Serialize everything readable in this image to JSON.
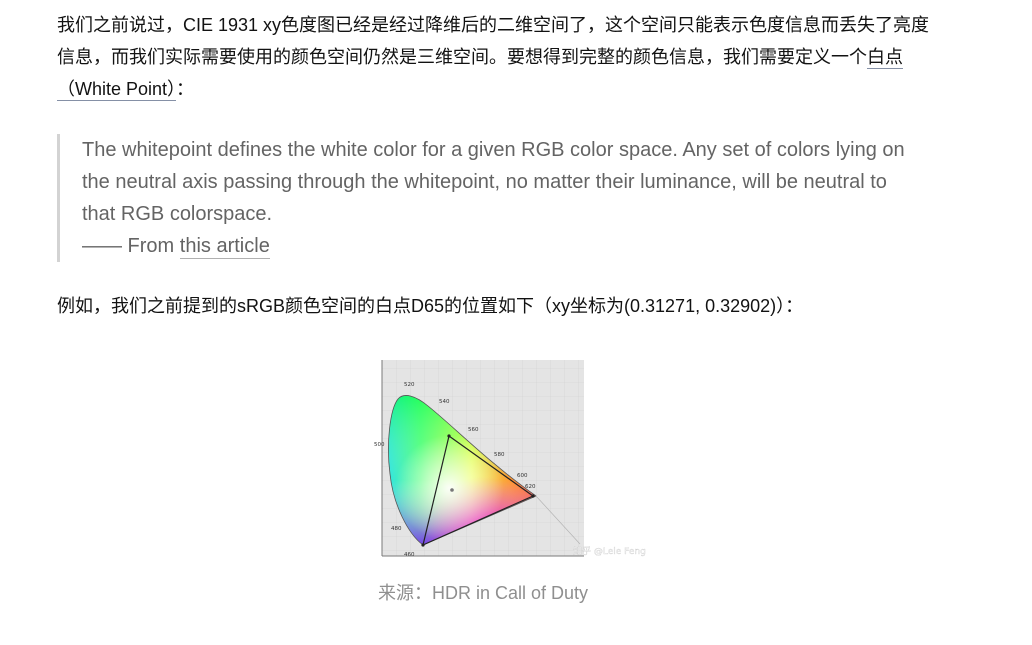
{
  "paragraph1": {
    "text_before_link": "我们之前说过，CIE 1931 xy色度图已经是经过降维后的二维空间了，这个空间只能表示色度信息而丢失了亮度信息，而我们实际需要使用的颜色空间仍然是三维空间。要想得到完整的颜色信息，我们需要定义一个",
    "link_text": "白点（White Point）",
    "text_after_link": "："
  },
  "blockquote": {
    "text": "The whitepoint defines the white color for a given RGB color space. Any set of colors lying on the neutral axis passing through the whitepoint, no matter their luminance, will be neutral to that RGB colorspace.",
    "attribution_prefix": "—— From ",
    "attribution_link": "this article"
  },
  "paragraph2": {
    "text": "例如，我们之前提到的sRGB颜色空间的白点D65的位置如下（xy坐标为(0.31271, 0.32902)）："
  },
  "figure": {
    "wavelength_labels": [
      "520",
      "540",
      "560",
      "580",
      "600",
      "620",
      "500",
      "480",
      "460"
    ],
    "watermark": "知乎 @Lele Feng",
    "caption": "来源：HDR in Call of Duty"
  }
}
